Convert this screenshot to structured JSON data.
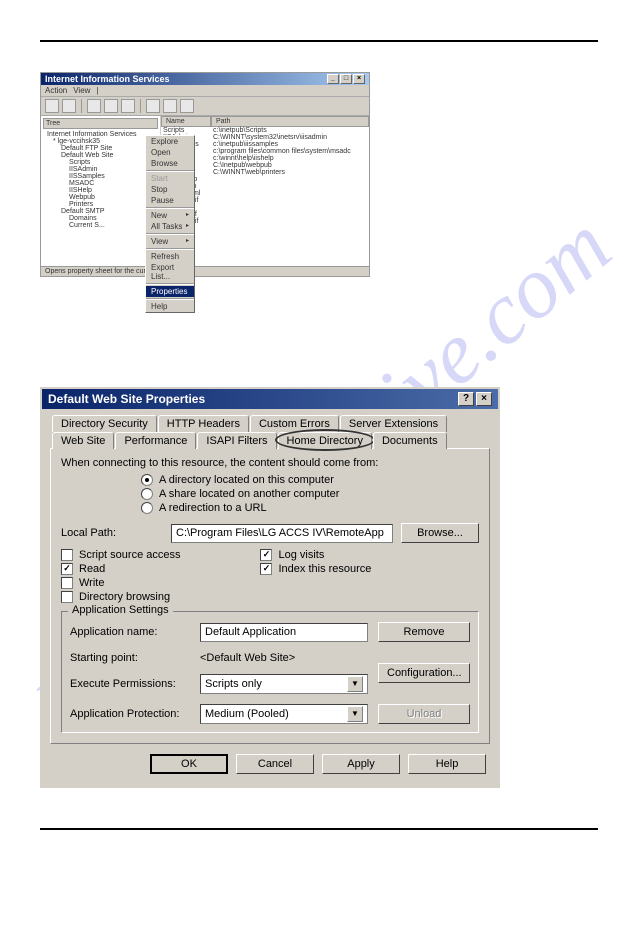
{
  "watermark": "manualsarchive.com",
  "iis": {
    "title": "Internet Information Services",
    "menu": {
      "action": "Action",
      "view": "View"
    },
    "tree_header": "Tree",
    "tree": {
      "root": "Internet Information Services",
      "host": "* lge-vccihsk35",
      "ftp": "Default FTP Site",
      "web": "Default Web Site",
      "items": [
        "Scripts",
        "IISAdmin",
        "IISSamples",
        "MSADC",
        "IISHelp",
        "Webpub",
        "Printers"
      ],
      "smtp": "Default SMTP",
      "domains": "Domains",
      "current": "Current S..."
    },
    "list_headers": {
      "name": "Name",
      "path": "Path"
    },
    "list": [
      {
        "name": "Scripts",
        "path": "c:\\inetpub\\Scripts"
      },
      {
        "name": "IISAdmin",
        "path": "C:\\WINNT\\system32\\inetsrv\\iisadmin"
      },
      {
        "name": "IISSamples",
        "path": "c:\\inetpub\\iissamples"
      },
      {
        "name": "MSADC",
        "path": "c:\\program files\\common files\\system\\msadc"
      },
      {
        "name": "IISHelp",
        "path": "c:\\winnt\\help\\iishelp"
      },
      {
        "name": "Webpub",
        "path": "C:\\Inetpub\\webpub"
      },
      {
        "name": "Printers",
        "path": "C:\\WINNT\\web\\printers"
      },
      {
        "name": "default.asp",
        "path": ""
      },
      {
        "name": "iisstart.asp",
        "path": ""
      },
      {
        "name": "_vti_inf.html",
        "path": ""
      },
      {
        "name": "pagerror.gif",
        "path": ""
      },
      {
        "name": "mmc.gif",
        "path": ""
      },
      {
        "name": "warning.gif",
        "path": ""
      },
      {
        "name": "win2000.gif",
        "path": ""
      }
    ],
    "context_menu": {
      "explore": "Explore",
      "open": "Open",
      "browse": "Browse",
      "start": "Start",
      "stop": "Stop",
      "pause": "Pause",
      "new": "New",
      "all_tasks": "All Tasks",
      "view": "View",
      "refresh": "Refresh",
      "export": "Export List...",
      "properties": "Properties",
      "help": "Help"
    },
    "status": "Opens property sheet for the current selection."
  },
  "props": {
    "title": "Default Web Site Properties",
    "tabs_row1": {
      "dir_sec": "Directory Security",
      "http": "HTTP Headers",
      "errors": "Custom Errors",
      "ext": "Server Extensions"
    },
    "tabs_row2": {
      "website": "Web Site",
      "perf": "Performance",
      "isapi": "ISAPI Filters",
      "home": "Home Directory",
      "docs": "Documents"
    },
    "connect_label": "When connecting to this resource, the content should come from:",
    "radios": {
      "dir": "A directory located on this computer",
      "share": "A share located on another computer",
      "url": "A redirection to a URL"
    },
    "local_path_label": "Local Path:",
    "local_path_value": "C:\\Program Files\\LG ACCS IV\\RemoteApp",
    "browse": "Browse...",
    "checks": {
      "script": "Script source access",
      "read": "Read",
      "write": "Write",
      "dirbrowse": "Directory browsing",
      "log": "Log visits",
      "index": "Index this resource"
    },
    "app_settings_title": "Application Settings",
    "app_name_label": "Application name:",
    "app_name_value": "Default Application",
    "start_label": "Starting point:",
    "start_value": "<Default Web Site>",
    "exec_label": "Execute Permissions:",
    "exec_value": "Scripts only",
    "prot_label": "Application Protection:",
    "prot_value": "Medium (Pooled)",
    "btn_remove": "Remove",
    "btn_config": "Configuration...",
    "btn_unload": "Unload",
    "btn_ok": "OK",
    "btn_cancel": "Cancel",
    "btn_apply": "Apply",
    "btn_help": "Help"
  }
}
